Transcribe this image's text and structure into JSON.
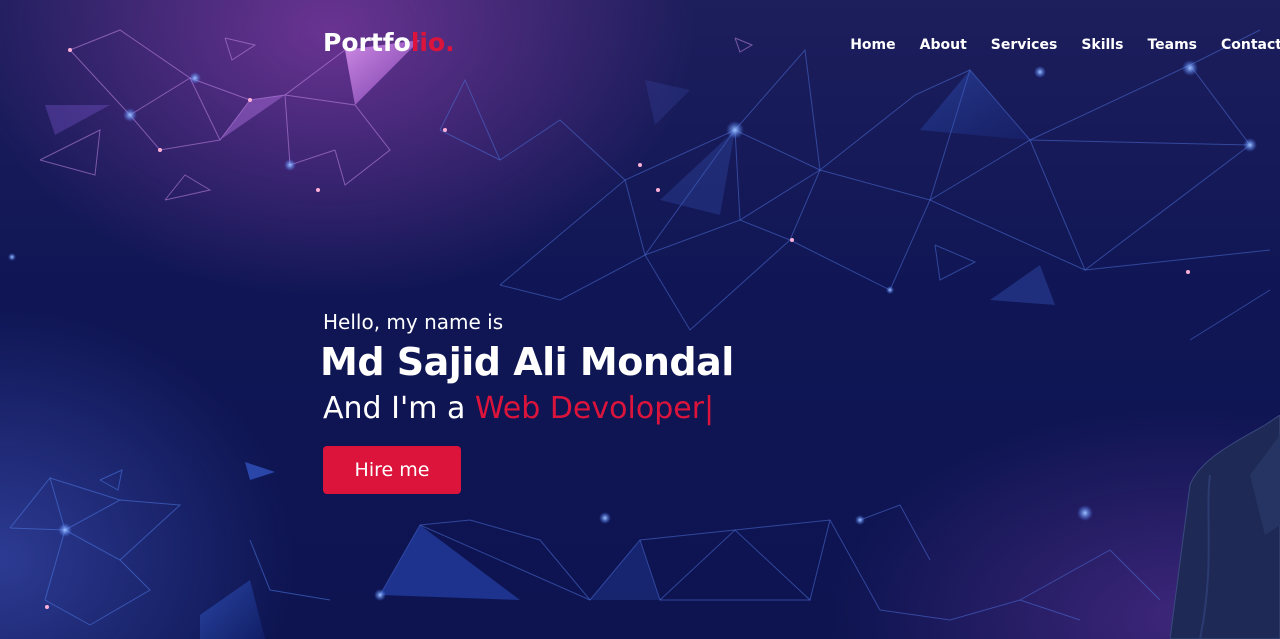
{
  "nav": {
    "logo": {
      "text": "Portfo",
      "accent": "lio."
    },
    "items": [
      {
        "label": "Home"
      },
      {
        "label": "About"
      },
      {
        "label": "Services"
      },
      {
        "label": "Skills"
      },
      {
        "label": "Teams"
      },
      {
        "label": "Contact"
      }
    ]
  },
  "hero": {
    "greeting": "Hello, my name is",
    "name": "Md Sajid Ali Mondal",
    "role_prefix": "And I'm a ",
    "role_typed": "Web Devoloper",
    "cursor": "|",
    "button_label": "Hire me"
  },
  "colors": {
    "accent": "#dc143c",
    "background": "#101655",
    "text": "#ffffff"
  }
}
